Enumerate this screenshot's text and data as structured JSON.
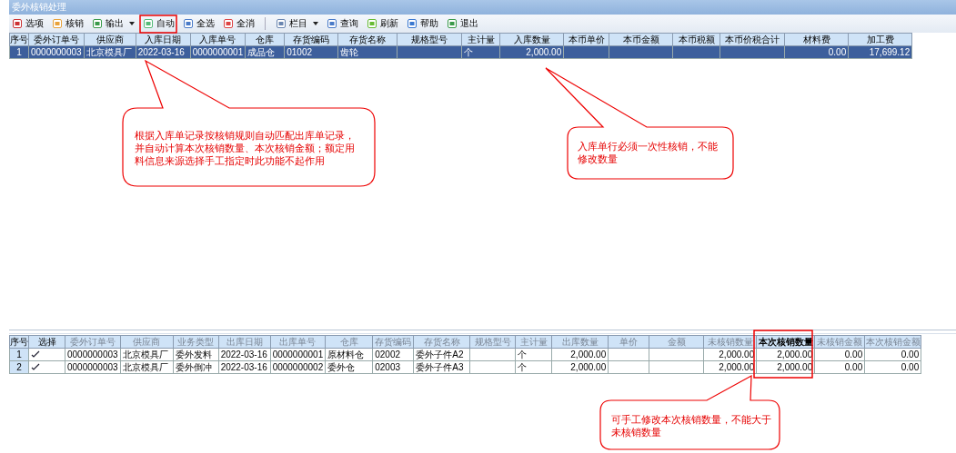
{
  "window": {
    "title": "委外核销处理"
  },
  "toolbar": {
    "groups": [
      [
        {
          "label": "选项",
          "kind": "button"
        },
        {
          "label": "核销",
          "kind": "button"
        },
        {
          "label": "输出",
          "kind": "dropdown"
        },
        {
          "label": "自动",
          "kind": "button"
        },
        {
          "label": "全选",
          "kind": "button"
        },
        {
          "label": "全消",
          "kind": "button"
        }
      ],
      [
        {
          "label": "栏目",
          "kind": "dropdown"
        },
        {
          "label": "查询",
          "kind": "button"
        },
        {
          "label": "刷新",
          "kind": "button"
        },
        {
          "label": "帮助",
          "kind": "button"
        },
        {
          "label": "退出",
          "kind": "button"
        }
      ]
    ]
  },
  "receipt_table": {
    "columns": [
      {
        "label": "序号"
      },
      {
        "label": "委外订单号"
      },
      {
        "label": "供应商"
      },
      {
        "label": "入库日期"
      },
      {
        "label": "入库单号"
      },
      {
        "label": "仓库"
      },
      {
        "label": "存货编码"
      },
      {
        "label": "存货名称"
      },
      {
        "label": "规格型号"
      },
      {
        "label": "主计量"
      },
      {
        "label": "入库数量"
      },
      {
        "label": "本币单价"
      },
      {
        "label": "本币金额"
      },
      {
        "label": "本币税额"
      },
      {
        "label": "本币价税合计"
      },
      {
        "label": "材料费"
      },
      {
        "label": "加工费"
      }
    ],
    "rows": [
      {
        "selected": true,
        "cells": [
          "1",
          "0000000003",
          "北京模具厂",
          "2022-03-16",
          "0000000001",
          "成品仓",
          "01002",
          "齿轮",
          "",
          "个",
          "2,000.00",
          "",
          "",
          "",
          "",
          "0.00",
          "17,699.12"
        ]
      }
    ]
  },
  "issue_table": {
    "columns": [
      {
        "label": "序号",
        "kind": "fixed"
      },
      {
        "label": "选择",
        "kind": "fixed"
      },
      {
        "label": "委外订单号",
        "kind": "readonly"
      },
      {
        "label": "供应商",
        "kind": "readonly"
      },
      {
        "label": "业务类型",
        "kind": "readonly"
      },
      {
        "label": "出库日期",
        "kind": "readonly"
      },
      {
        "label": "出库单号",
        "kind": "readonly"
      },
      {
        "label": "仓库",
        "kind": "readonly"
      },
      {
        "label": "存货编码",
        "kind": "readonly"
      },
      {
        "label": "存货名称",
        "kind": "readonly"
      },
      {
        "label": "规格型号",
        "kind": "readonly"
      },
      {
        "label": "主计量",
        "kind": "readonly"
      },
      {
        "label": "出库数量",
        "kind": "readonly"
      },
      {
        "label": "单价",
        "kind": "readonly"
      },
      {
        "label": "金额",
        "kind": "readonly"
      },
      {
        "label": "未核销数量",
        "kind": "readonly"
      },
      {
        "label": "本次核销数量",
        "kind": "editable"
      },
      {
        "label": "未核销金额",
        "kind": "readonly"
      },
      {
        "label": "本次核销金额",
        "kind": "readonly"
      }
    ],
    "rows": [
      {
        "selected": false,
        "checked": true,
        "cells": [
          "1",
          "",
          "0000000003",
          "北京模具厂",
          "委外发料",
          "2022-03-16",
          "0000000001",
          "原材料仓",
          "02002",
          "委外子件A2",
          "",
          "个",
          "2,000.00",
          "",
          "",
          "2,000.00",
          "2,000.00",
          "0.00",
          "0.00"
        ]
      },
      {
        "selected": false,
        "checked": true,
        "cells": [
          "2",
          "",
          "0000000003",
          "北京模具厂",
          "委外倒冲",
          "2022-03-16",
          "0000000002",
          "委外仓",
          "02003",
          "委外子件A3",
          "",
          "个",
          "2,000.00",
          "",
          "",
          "2,000.00",
          "2,000.00",
          "0.00",
          "0.00"
        ]
      }
    ]
  },
  "annotations": [
    {
      "text": "根据入库单记录按核销规则自动匹配出库单记录，并自动计算本次核销数量、本次核销金额；额定用料信息来源选择手工指定时此功能不起作用"
    },
    {
      "text": "入库单行必须一次性核销，不能修改数量"
    },
    {
      "text": "可手工修改本次核销数量，不能大于未核销数量"
    }
  ]
}
